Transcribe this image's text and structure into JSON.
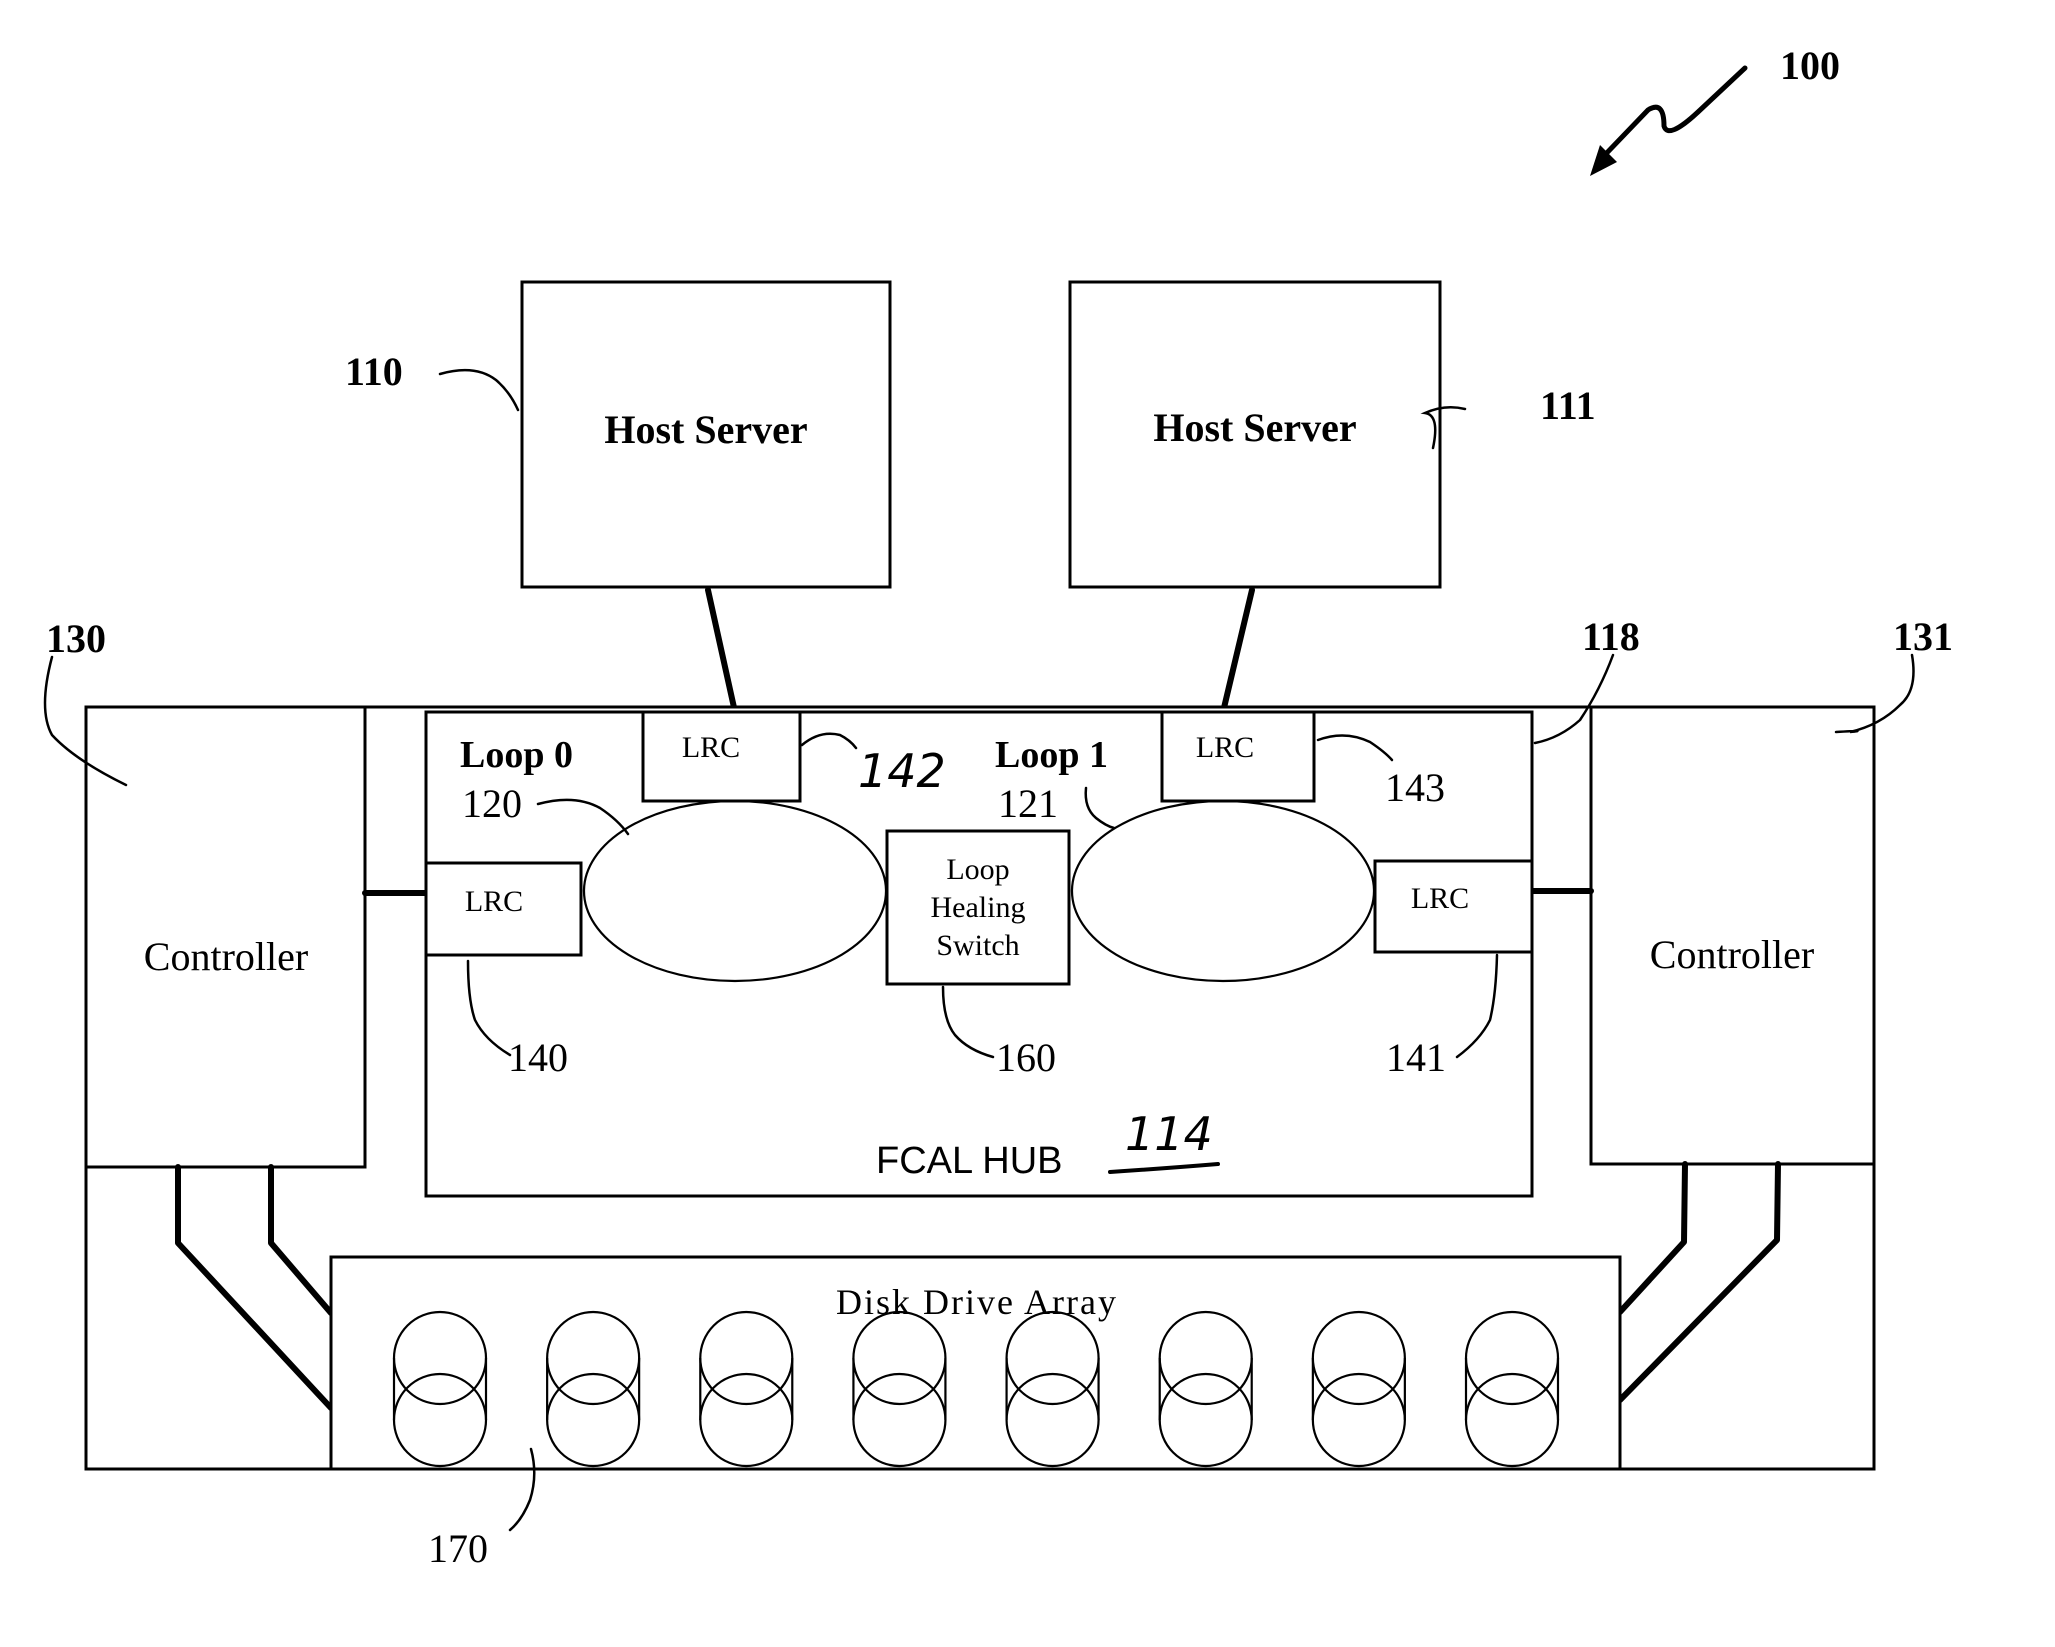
{
  "figure": {
    "ref": "100",
    "hosts": [
      {
        "label": "Host Server",
        "ref": "110"
      },
      {
        "label": "Host Server",
        "ref": "111"
      }
    ],
    "controllers": [
      {
        "label": "Controller",
        "ref": "130"
      },
      {
        "label": "Controller",
        "ref": "131"
      }
    ],
    "hub": {
      "label": "FCAL HUB",
      "ref": "114",
      "enclosure_ref": "118",
      "loops": [
        {
          "label": "Loop 0",
          "ref": "120"
        },
        {
          "label": "Loop 1",
          "ref": "121"
        }
      ],
      "lrcs": [
        {
          "label": "LRC",
          "ref": "140"
        },
        {
          "label": "LRC",
          "ref": "141"
        },
        {
          "label": "LRC",
          "ref": "142"
        },
        {
          "label": "LRC",
          "ref": "143"
        }
      ],
      "switch": {
        "lines": [
          "Loop",
          "Healing",
          "Switch"
        ],
        "ref": "160"
      }
    },
    "disk_array": {
      "label": "Disk Drive Array",
      "ref": "170",
      "disk_count": 8
    }
  }
}
